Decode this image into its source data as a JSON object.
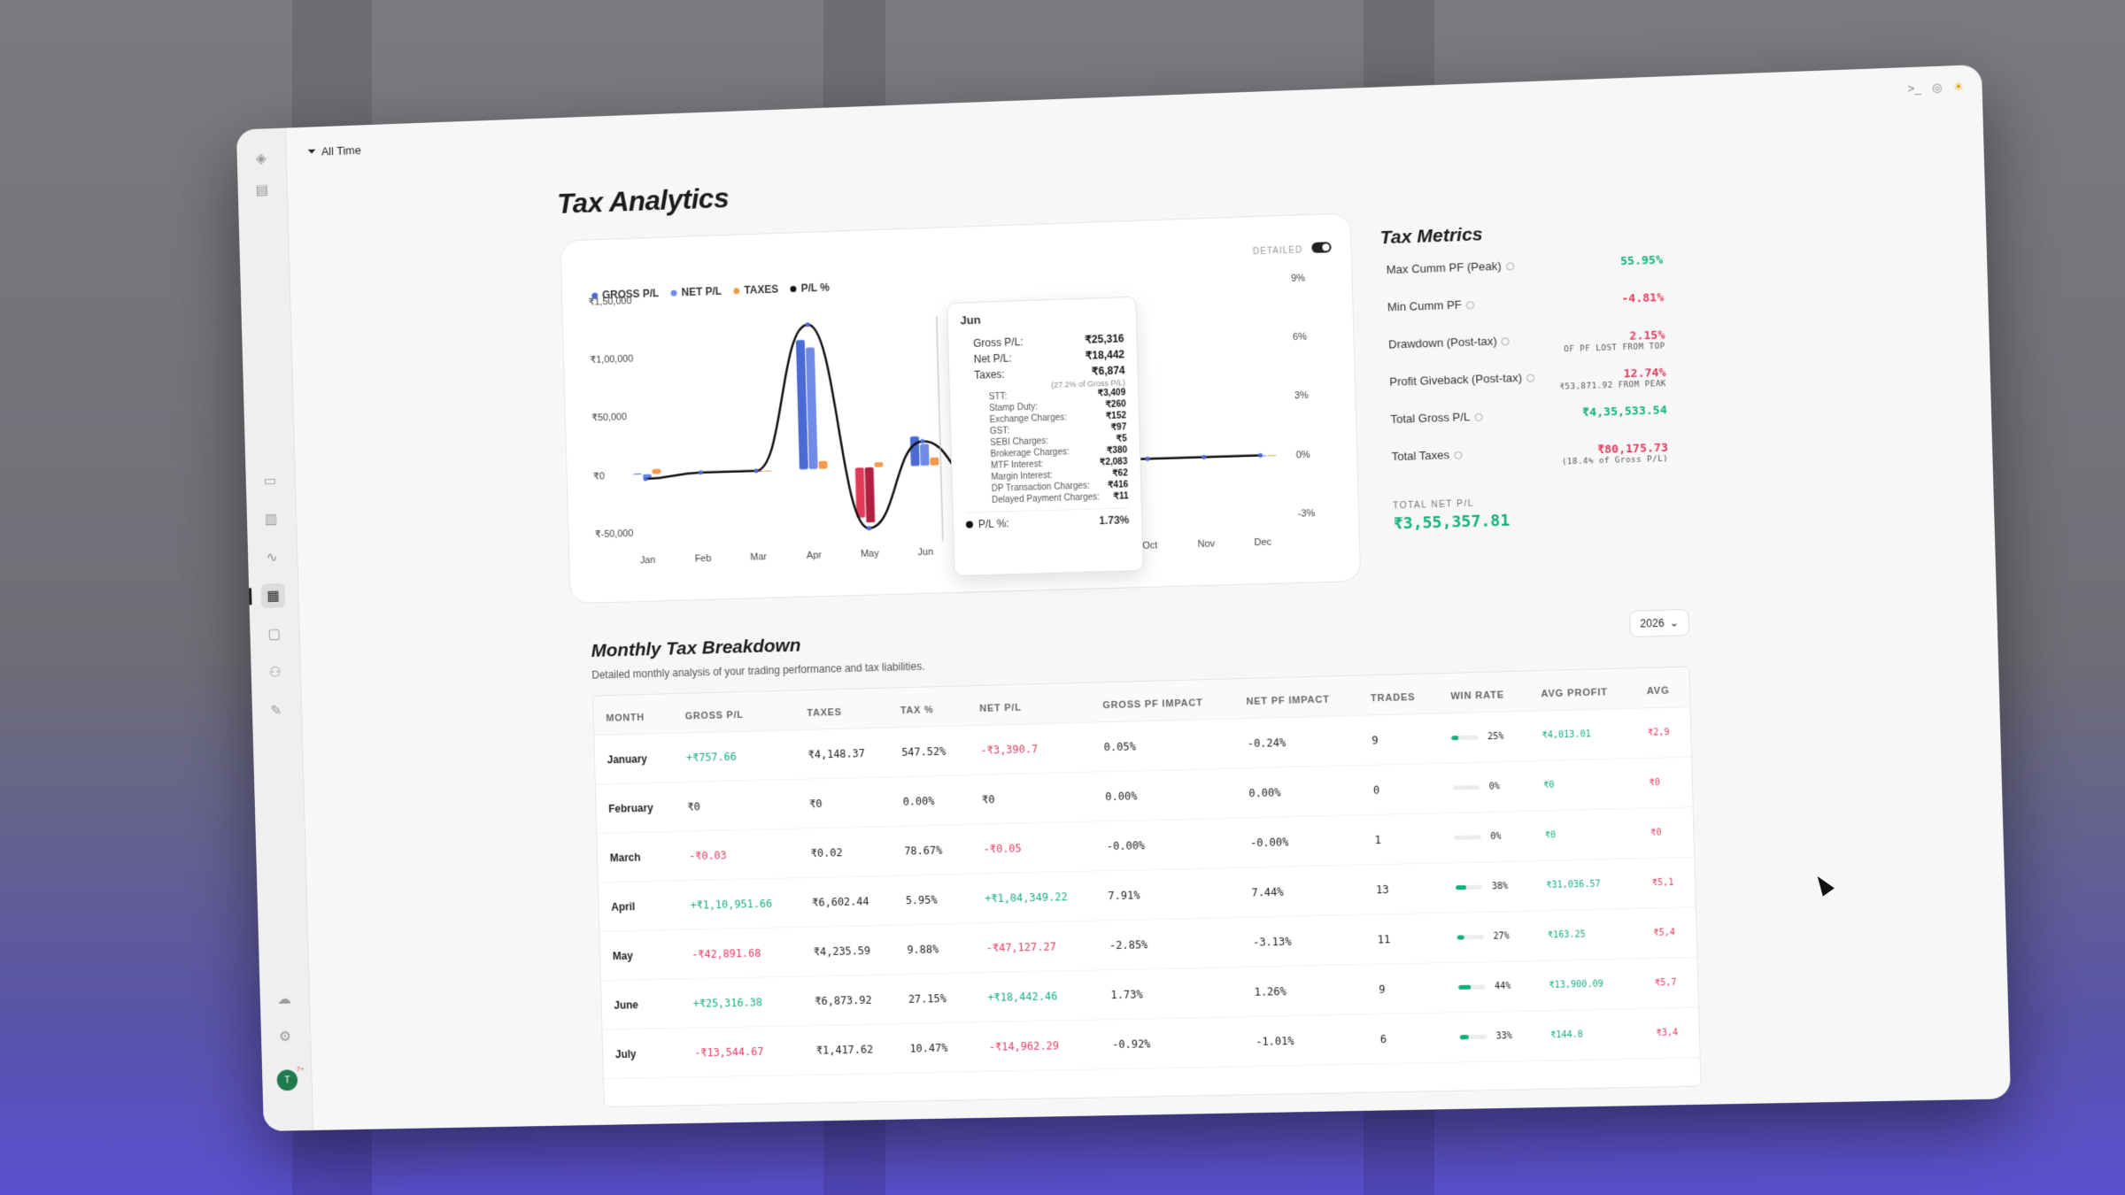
{
  "topbar": {
    "filter_label": "All Time"
  },
  "page_title": "Tax Analytics",
  "chart": {
    "legend": [
      "GROSS P/L",
      "NET P/L",
      "TAXES",
      "P/L %"
    ],
    "legend_colors": [
      "#4a6bd6",
      "#6f8be6",
      "#f29a4a",
      "#111111"
    ],
    "detailed_label": "DETAILED",
    "detailed_on": true
  },
  "chart_data": {
    "type": "bar",
    "categories": [
      "Jan",
      "Feb",
      "Mar",
      "Apr",
      "May",
      "Jun",
      "Jul",
      "Aug",
      "Sep",
      "Oct",
      "Nov",
      "Dec"
    ],
    "y_left_ticks": [
      "₹1,50,000",
      "₹1,00,000",
      "₹50,000",
      "₹0",
      "₹-50,000"
    ],
    "y_right_ticks": [
      "9%",
      "6%",
      "3%",
      "0%",
      "-3%"
    ],
    "ylim": [
      -50000,
      150000
    ],
    "y2lim": [
      -3,
      9
    ],
    "series": [
      {
        "name": "GROSS P/L",
        "values": [
          757.66,
          0,
          -0.03,
          110951.66,
          -42891.68,
          25316.38,
          -13544.67,
          0,
          0,
          0,
          0,
          0
        ]
      },
      {
        "name": "NET P/L",
        "values": [
          -3390.7,
          0,
          -0.05,
          104349.22,
          -47127.27,
          18442.46,
          -14962.29,
          0,
          0,
          0,
          0,
          0
        ]
      },
      {
        "name": "TAXES",
        "values": [
          4148.37,
          0,
          0.02,
          6602.44,
          4235.59,
          6873.92,
          1417.62,
          0,
          0,
          0,
          0,
          0
        ]
      },
      {
        "name": "P/L %",
        "values": [
          -0.24,
          0,
          0,
          7.44,
          -3.13,
          1.26,
          -1.01,
          0,
          0,
          0,
          0,
          0
        ]
      }
    ]
  },
  "tooltip": {
    "month": "Jun",
    "gross_label": "Gross P/L:",
    "gross": "₹25,316",
    "net_label": "Net P/L:",
    "net": "₹18,442",
    "taxes_label": "Taxes:",
    "taxes": "₹6,874",
    "taxes_note": "(27.2% of Gross P/L)",
    "items": [
      {
        "label": "STT:",
        "value": "₹3,409"
      },
      {
        "label": "Stamp Duty:",
        "value": "₹260"
      },
      {
        "label": "Exchange Charges:",
        "value": "₹152"
      },
      {
        "label": "GST:",
        "value": "₹97"
      },
      {
        "label": "SEBI Charges:",
        "value": "₹5"
      },
      {
        "label": "Brokerage Charges:",
        "value": "₹380"
      },
      {
        "label": "MTF Interest:",
        "value": "₹2,083"
      },
      {
        "label": "Margin Interest:",
        "value": "₹62"
      },
      {
        "label": "DP Transaction Charges:",
        "value": "₹416"
      },
      {
        "label": "Delayed Payment Charges:",
        "value": "₹11"
      }
    ],
    "pl_label": "P/L %:",
    "pl": "1.73%"
  },
  "metrics": {
    "title": "Tax Metrics",
    "rows": [
      {
        "label": "Max Cumm PF (Peak)",
        "value": "55.95%",
        "note": "",
        "tone": "pos"
      },
      {
        "label": "Min Cumm PF",
        "value": "-4.81%",
        "note": "",
        "tone": "neg"
      },
      {
        "label": "Drawdown (Post-tax)",
        "value": "2.15%",
        "note": "OF PF LOST FROM TOP",
        "tone": "neg"
      },
      {
        "label": "Profit Giveback (Post-tax)",
        "value": "12.74%",
        "note": "₹53,871.92 FROM PEAK",
        "tone": "neg"
      },
      {
        "label": "Total Gross P/L",
        "value": "₹4,35,533.54",
        "note": "",
        "tone": "pos"
      },
      {
        "label": "Total Taxes",
        "value": "₹80,175.73",
        "note": "(18.4% of Gross P/L)",
        "tone": "neg"
      }
    ],
    "total_net_label": "TOTAL NET P/L",
    "total_net_value": "₹3,55,357.81"
  },
  "breakdown": {
    "title": "Monthly Tax Breakdown",
    "subtitle": "Detailed monthly analysis of your trading performance and tax liabilities.",
    "year": "2026",
    "columns": [
      "MONTH",
      "GROSS P/L",
      "TAXES",
      "TAX %",
      "NET P/L",
      "GROSS PF IMPACT",
      "NET PF IMPACT",
      "TRADES",
      "WIN RATE",
      "AVG PROFIT",
      "AVG"
    ],
    "rows": [
      {
        "month": "January",
        "gross": "+₹757.66",
        "gross_tone": "pos",
        "taxes": "₹4,148.37",
        "tax_pct": "547.52%",
        "net": "-₹3,390.7",
        "net_tone": "neg",
        "gpf": "0.05%",
        "npf": "-0.24%",
        "trades": "9",
        "win": "25%",
        "win_frac": 0.25,
        "avg_profit": "₹4,013.01",
        "avg_loss": "₹2,9"
      },
      {
        "month": "February",
        "gross": "₹0",
        "gross_tone": "",
        "taxes": "₹0",
        "tax_pct": "0.00%",
        "net": "₹0",
        "net_tone": "",
        "gpf": "0.00%",
        "npf": "0.00%",
        "trades": "0",
        "win": "0%",
        "win_frac": 0,
        "avg_profit": "₹0",
        "avg_loss": "₹0"
      },
      {
        "month": "March",
        "gross": "-₹0.03",
        "gross_tone": "neg",
        "taxes": "₹0.02",
        "tax_pct": "78.67%",
        "net": "-₹0.05",
        "net_tone": "neg",
        "gpf": "-0.00%",
        "npf": "-0.00%",
        "trades": "1",
        "win": "0%",
        "win_frac": 0,
        "avg_profit": "₹0",
        "avg_loss": "₹0"
      },
      {
        "month": "April",
        "gross": "+₹1,10,951.66",
        "gross_tone": "pos",
        "taxes": "₹6,602.44",
        "tax_pct": "5.95%",
        "net": "+₹1,04,349.22",
        "net_tone": "pos",
        "gpf": "7.91%",
        "npf": "7.44%",
        "trades": "13",
        "win": "38%",
        "win_frac": 0.38,
        "avg_profit": "₹31,036.57",
        "avg_loss": "₹5,1"
      },
      {
        "month": "May",
        "gross": "-₹42,891.68",
        "gross_tone": "neg",
        "taxes": "₹4,235.59",
        "tax_pct": "9.88%",
        "net": "-₹47,127.27",
        "net_tone": "neg",
        "gpf": "-2.85%",
        "npf": "-3.13%",
        "trades": "11",
        "win": "27%",
        "win_frac": 0.27,
        "avg_profit": "₹163.25",
        "avg_loss": "₹5,4"
      },
      {
        "month": "June",
        "gross": "+₹25,316.38",
        "gross_tone": "pos",
        "taxes": "₹6,873.92",
        "tax_pct": "27.15%",
        "net": "+₹18,442.46",
        "net_tone": "pos",
        "gpf": "1.73%",
        "npf": "1.26%",
        "trades": "9",
        "win": "44%",
        "win_frac": 0.44,
        "avg_profit": "₹13,900.09",
        "avg_loss": "₹5,7"
      },
      {
        "month": "July",
        "gross": "-₹13,544.67",
        "gross_tone": "neg",
        "taxes": "₹1,417.62",
        "tax_pct": "10.47%",
        "net": "-₹14,962.29",
        "net_tone": "neg",
        "gpf": "-0.92%",
        "npf": "-1.01%",
        "trades": "6",
        "win": "33%",
        "win_frac": 0.33,
        "avg_profit": "₹144.8",
        "avg_loss": "₹3,4"
      }
    ]
  },
  "sidebar": {
    "icons": [
      "logo-icon",
      "panel-icon",
      "book-icon",
      "bar-chart-icon",
      "activity-icon",
      "tax-doc-icon",
      "calendar-icon",
      "users-icon",
      "pen-icon",
      "cloud-icon",
      "settings-icon"
    ],
    "avatar_initial": "T",
    "avatar_badge": "7+"
  }
}
